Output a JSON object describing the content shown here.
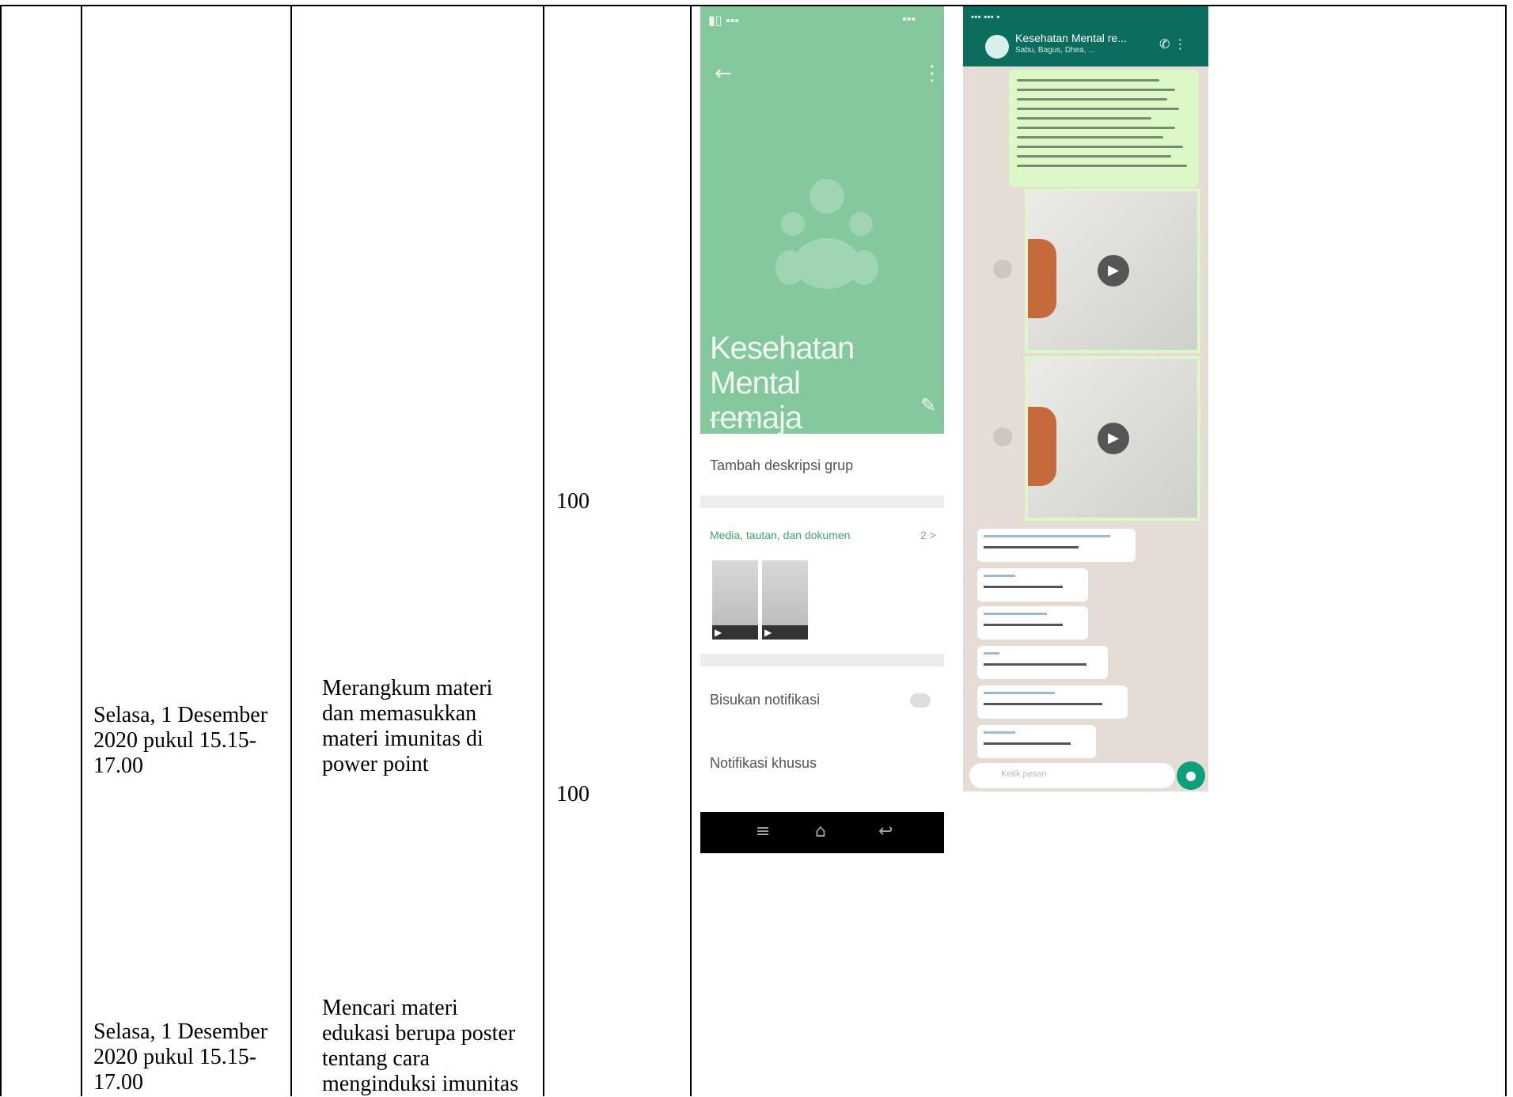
{
  "table": {
    "rows": [
      {
        "date": "Selasa, 1 Desember\n2020 pukul 15.15-\n17.00",
        "activity": "Merangkum materi\ndan memasukkan\nmateri imunitas di\npower point",
        "score_top": "100",
        "score_bottom": "100"
      },
      {
        "date": "Selasa, 1 Desember\n2020 pukul 15.15-\n17.00",
        "activity": "Mencari materi\nedukasi berupa poster\ntentang cara\nmenginduksi imunitas"
      }
    ]
  },
  "screenshot_group_info": {
    "group_name": "Kesehatan Mental\nremaja",
    "row_1": "Tambah deskripsi grup",
    "media_label": "Media, tautan, dan dokumen",
    "media_count": "2 >",
    "row_2": "Bisukan notifikasi",
    "row_3": "Notifikasi khusus",
    "back_icon": "arrow-left-icon",
    "menu_icon": "more-vert-icon"
  },
  "screenshot_chat": {
    "chat_title": "Kesehatan Mental re...",
    "chat_subtitle": "Sabu, Bagus, Dhea, ...",
    "input_placeholder": "Ketik pesan",
    "accent": "#0c6d5f",
    "bubble_color": "#dcf8c6"
  },
  "colors": {
    "header_green": "#86c89e",
    "chat_background": "#e5ddd5"
  }
}
